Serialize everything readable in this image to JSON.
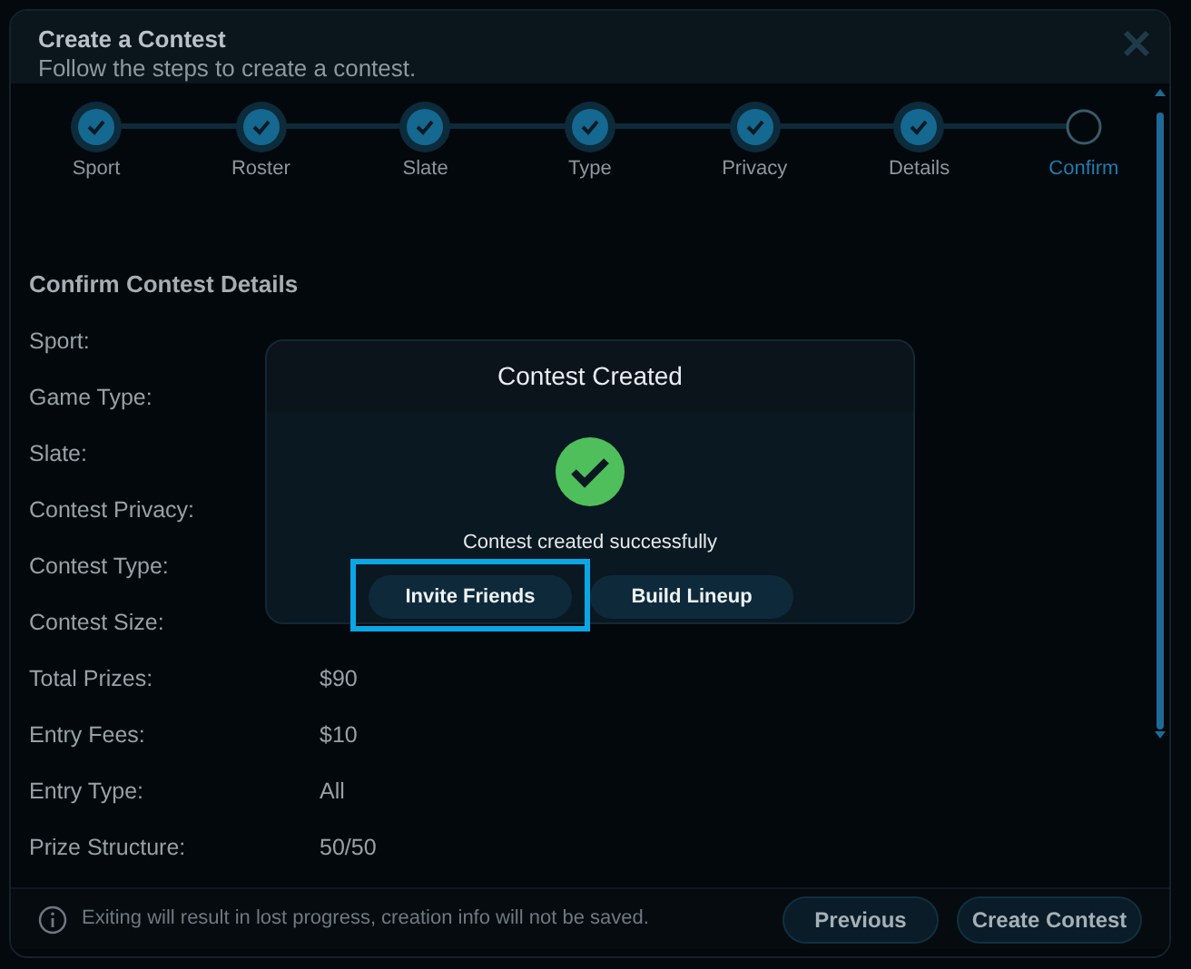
{
  "modal": {
    "title": "Create a Contest",
    "subtitle": "Follow the steps to create a contest."
  },
  "steps": [
    {
      "label": "Sport",
      "completed": true,
      "current": false
    },
    {
      "label": "Roster",
      "completed": true,
      "current": false
    },
    {
      "label": "Slate",
      "completed": true,
      "current": false
    },
    {
      "label": "Type",
      "completed": true,
      "current": false
    },
    {
      "label": "Privacy",
      "completed": true,
      "current": false
    },
    {
      "label": "Details",
      "completed": true,
      "current": false
    },
    {
      "label": "Confirm",
      "completed": false,
      "current": true
    }
  ],
  "details": {
    "heading": "Confirm Contest Details",
    "rows": [
      {
        "label": "Sport:"
      },
      {
        "label": "Game Type:"
      },
      {
        "label": "Slate:"
      },
      {
        "label": "Contest Privacy:"
      },
      {
        "label": "Contest Type:"
      },
      {
        "label": "Contest Size:"
      },
      {
        "label": "Total Prizes:",
        "value": "$90"
      },
      {
        "label": "Entry Fees:",
        "value": "$10"
      },
      {
        "label": "Entry Type:",
        "value": "All"
      },
      {
        "label": "Prize Structure:",
        "value": "50/50"
      }
    ]
  },
  "footer": {
    "notice": "Exiting will result in lost progress, creation info will not be saved.",
    "buttons": [
      "Previous",
      "Create Contest"
    ]
  },
  "dialog": {
    "title": "Contest Created",
    "message": "Contest created successfully",
    "buttons": [
      {
        "label": "Invite Friends",
        "highlighted": true
      },
      {
        "label": "Build Lineup",
        "highlighted": false
      }
    ]
  }
}
